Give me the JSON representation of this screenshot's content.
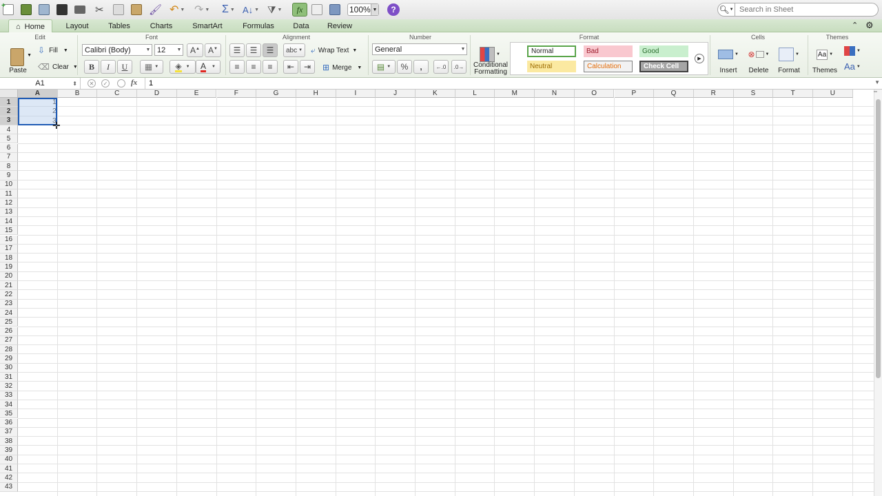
{
  "toolbar": {
    "zoom_value": "100%",
    "help_label": "?",
    "search_placeholder": "Search in Sheet"
  },
  "tabs": [
    {
      "label": "Home"
    },
    {
      "label": "Layout"
    },
    {
      "label": "Tables"
    },
    {
      "label": "Charts"
    },
    {
      "label": "SmartArt"
    },
    {
      "label": "Formulas"
    },
    {
      "label": "Data"
    },
    {
      "label": "Review"
    }
  ],
  "ribbon": {
    "edit": {
      "title": "Edit",
      "paste": "Paste",
      "fill": "Fill",
      "clear": "Clear"
    },
    "font": {
      "title": "Font",
      "font_name": "Calibri (Body)",
      "font_size": "12",
      "bold": "B",
      "italic": "I",
      "underline": "U"
    },
    "alignment": {
      "title": "Alignment",
      "wrap_text": "Wrap Text",
      "merge": "Merge",
      "abc": "abc"
    },
    "number": {
      "title": "Number",
      "format": "General",
      "percent": "%",
      "comma": "̩"
    },
    "format": {
      "title": "Format",
      "conditional_formatting_1": "Conditional",
      "conditional_formatting_2": "Formatting",
      "styles": {
        "normal": "Normal",
        "bad": "Bad",
        "good": "Good",
        "neutral": "Neutral",
        "calculation": "Calculation",
        "check_cell": "Check Cell"
      }
    },
    "cells": {
      "title": "Cells",
      "insert": "Insert",
      "delete": "Delete",
      "format": "Format"
    },
    "themes": {
      "title": "Themes",
      "themes_label": "Themes",
      "aa": "Aa"
    }
  },
  "formula_bar": {
    "name_box": "A1",
    "fx": "fx",
    "value": "1"
  },
  "sheet": {
    "columns": [
      "A",
      "B",
      "C",
      "D",
      "E",
      "F",
      "G",
      "H",
      "I",
      "J",
      "K",
      "L",
      "M",
      "N",
      "O",
      "P",
      "Q",
      "R",
      "S",
      "T",
      "U"
    ],
    "rows": [
      "1",
      "2",
      "3",
      "4",
      "5",
      "6",
      "7",
      "8",
      "9",
      "10",
      "11",
      "12",
      "13",
      "14",
      "15",
      "16",
      "17",
      "18",
      "19",
      "20",
      "21",
      "22",
      "23",
      "24",
      "25",
      "26",
      "27",
      "28",
      "29",
      "30",
      "31",
      "32",
      "33",
      "34",
      "35",
      "36",
      "37",
      "38",
      "39",
      "40",
      "41",
      "42",
      "43"
    ],
    "cells": {
      "A1": "1",
      "A2": "2",
      "A3": "3"
    },
    "selected_range": "A1:A3"
  },
  "colors": {
    "accent": "#1e5ab4",
    "ribbon_tab_bg": "#c8ddbf",
    "selection_fill": "#b4cdeb"
  }
}
